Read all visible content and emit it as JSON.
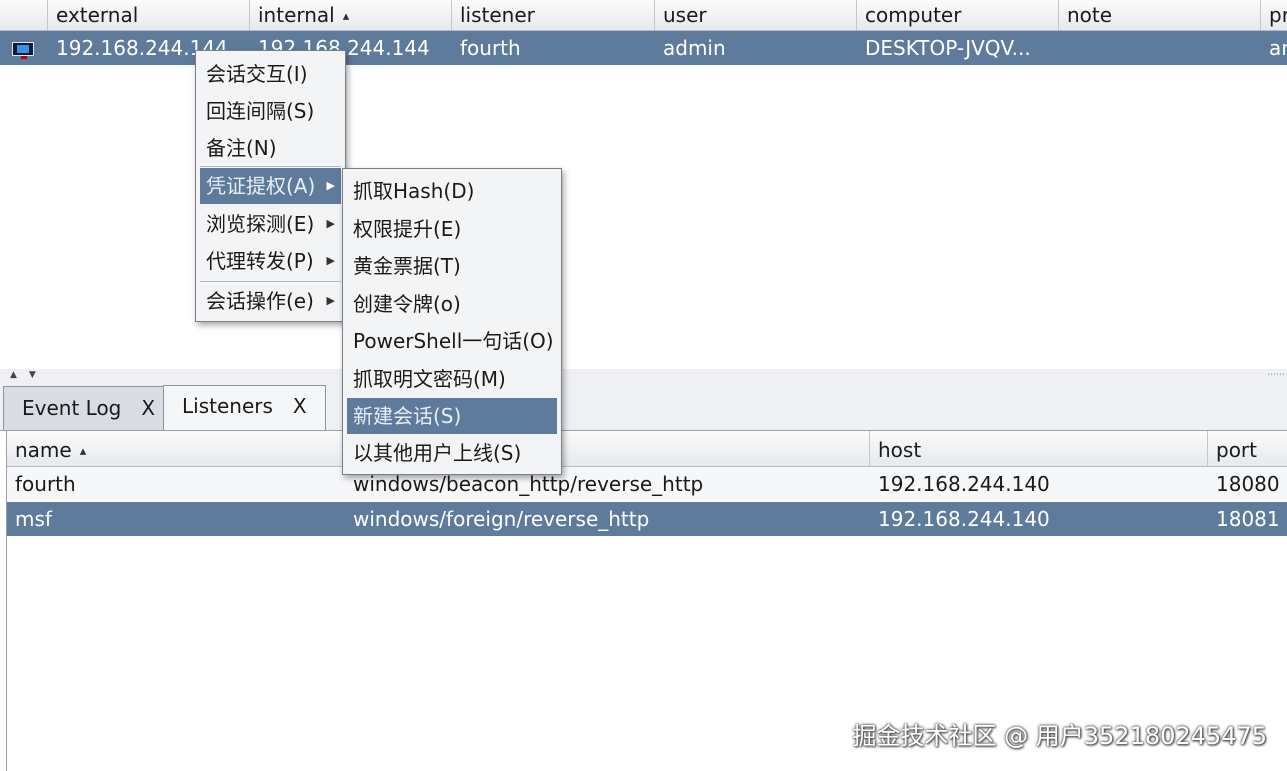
{
  "sessions_table": {
    "columns": [
      "",
      "external",
      "internal",
      "listener",
      "user",
      "computer",
      "note",
      "pr"
    ],
    "sorted_column": "internal",
    "row": {
      "os_icon": "windows-monitor-icon",
      "external": "192.168.244.144",
      "internal": "192.168.244.144",
      "listener": "fourth",
      "user": "admin",
      "computer": "DESKTOP-JVQV...",
      "note": "",
      "pr": "ar"
    }
  },
  "tabs": [
    {
      "label": "Event Log",
      "close": "X"
    },
    {
      "label": "Listeners",
      "close": "X"
    }
  ],
  "listeners_table": {
    "columns": [
      "name",
      "",
      "host",
      "port"
    ],
    "sorted_column": "name",
    "rows": [
      {
        "name": "fourth",
        "payload": "windows/beacon_http/reverse_http",
        "host": "192.168.244.140",
        "port": "18080"
      },
      {
        "name": "msf",
        "payload": "windows/foreign/reverse_http",
        "host": "192.168.244.140",
        "port": "18081"
      }
    ]
  },
  "context_menu": {
    "items": [
      {
        "label": "会话交互(I)",
        "submenu": false
      },
      {
        "label": "回连间隔(S)",
        "submenu": false
      },
      {
        "label": "备注(N)",
        "submenu": false
      },
      {
        "label": "凭证提权(A)",
        "submenu": true
      },
      {
        "label": "浏览探测(E)",
        "submenu": true
      },
      {
        "label": "代理转发(P)",
        "submenu": true
      },
      {
        "label": "会话操作(e)",
        "submenu": true
      }
    ],
    "highlighted": "凭证提权(A)"
  },
  "submenu": {
    "items": [
      "抓取Hash(D)",
      "权限提升(E)",
      "黄金票据(T)",
      "创建令牌(o)",
      "PowerShell一句话(O)",
      "抓取明文密码(M)",
      "新建会话(S)",
      "以其他用户上线(S)"
    ],
    "highlighted": "新建会话(S)"
  },
  "watermark": "掘金技术社区 @ 用户352180245475",
  "colors": {
    "selection": "#5e7b9b",
    "header_bg": "#e6e9ed",
    "menu_bg": "#f3f4f6"
  }
}
